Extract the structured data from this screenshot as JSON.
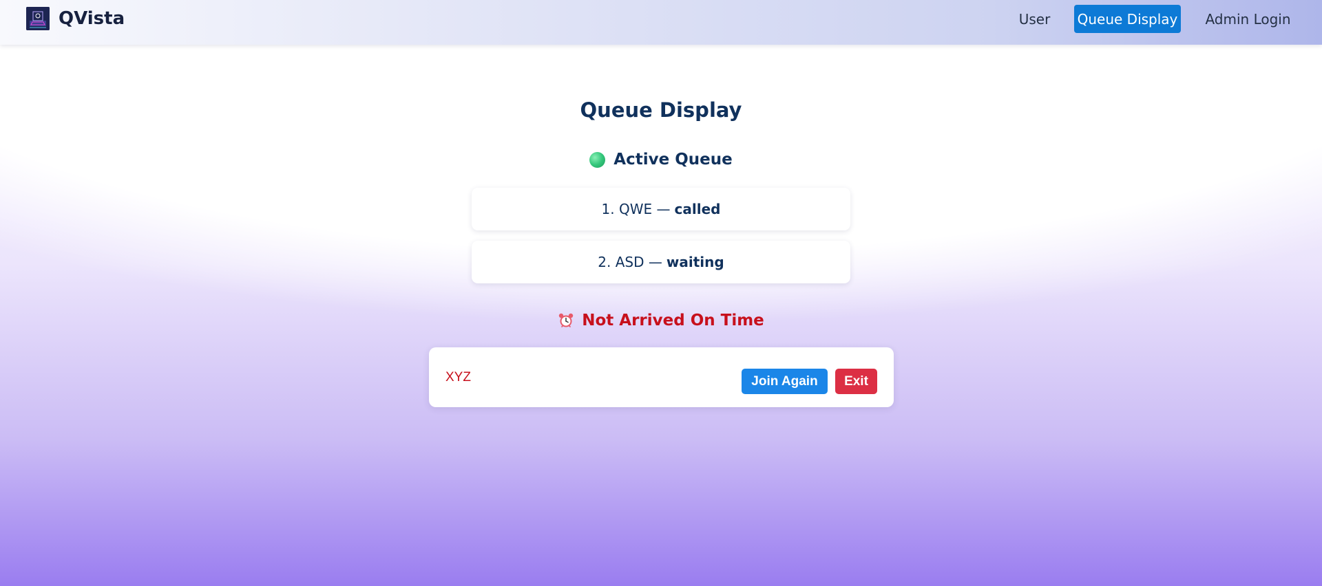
{
  "app": {
    "brand": "QVista"
  },
  "nav": {
    "items": [
      {
        "label": "User",
        "active": false
      },
      {
        "label": "Queue Display",
        "active": true
      },
      {
        "label": "Admin Login",
        "active": false
      }
    ]
  },
  "main": {
    "title": "Queue Display",
    "active_queue": {
      "heading": "Active Queue",
      "icon": "green-circle-icon",
      "separator": "—",
      "entries": [
        {
          "position": "1.",
          "name": "QWE",
          "status": "called"
        },
        {
          "position": "2.",
          "name": "ASD",
          "status": "waiting"
        }
      ]
    },
    "not_arrived": {
      "heading": "Not Arrived On Time",
      "icon": "alarm-clock-icon",
      "entries": [
        {
          "name": "XYZ",
          "join_label": "Join Again",
          "exit_label": "Exit"
        }
      ]
    }
  },
  "colors": {
    "accent": "#0d7ad6",
    "heading_text": "#10315c",
    "alert_red": "#c7101c",
    "join_button": "#1b86e8",
    "exit_button": "#dc2f44",
    "status_green": "#34c77b"
  }
}
